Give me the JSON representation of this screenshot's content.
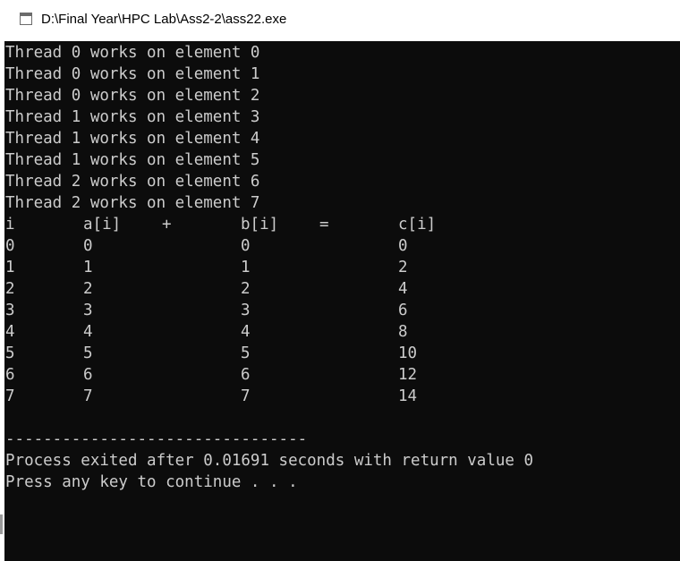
{
  "window": {
    "title": "D:\\Final Year\\HPC Lab\\Ass2-2\\ass22.exe"
  },
  "console": {
    "thread_lines": [
      "Thread 0 works on element 0",
      "Thread 0 works on element 1",
      "Thread 0 works on element 2",
      "Thread 1 works on element 3",
      "Thread 1 works on element 4",
      "Thread 1 works on element 5",
      "Thread 2 works on element 6",
      "Thread 2 works on element 7"
    ],
    "table_header": [
      "i",
      "a[i]",
      "+",
      "b[i]",
      "=",
      "c[i]"
    ],
    "table_rows": [
      [
        "0",
        "0",
        "0",
        "0"
      ],
      [
        "1",
        "1",
        "1",
        "2"
      ],
      [
        "2",
        "2",
        "2",
        "4"
      ],
      [
        "3",
        "3",
        "3",
        "6"
      ],
      [
        "4",
        "4",
        "4",
        "8"
      ],
      [
        "5",
        "5",
        "5",
        "10"
      ],
      [
        "6",
        "6",
        "6",
        "12"
      ],
      [
        "7",
        "7",
        "7",
        "14"
      ]
    ],
    "separator": "--------------------------------",
    "exit_message": "Process exited after 0.01691 seconds with return value 0",
    "continue_prompt": "Press any key to continue . . ."
  },
  "colors": {
    "console_bg": "#0c0c0c",
    "console_fg": "#cccccc",
    "titlebar_bg": "#ffffff"
  },
  "icons": {
    "app": "console-window-icon"
  }
}
